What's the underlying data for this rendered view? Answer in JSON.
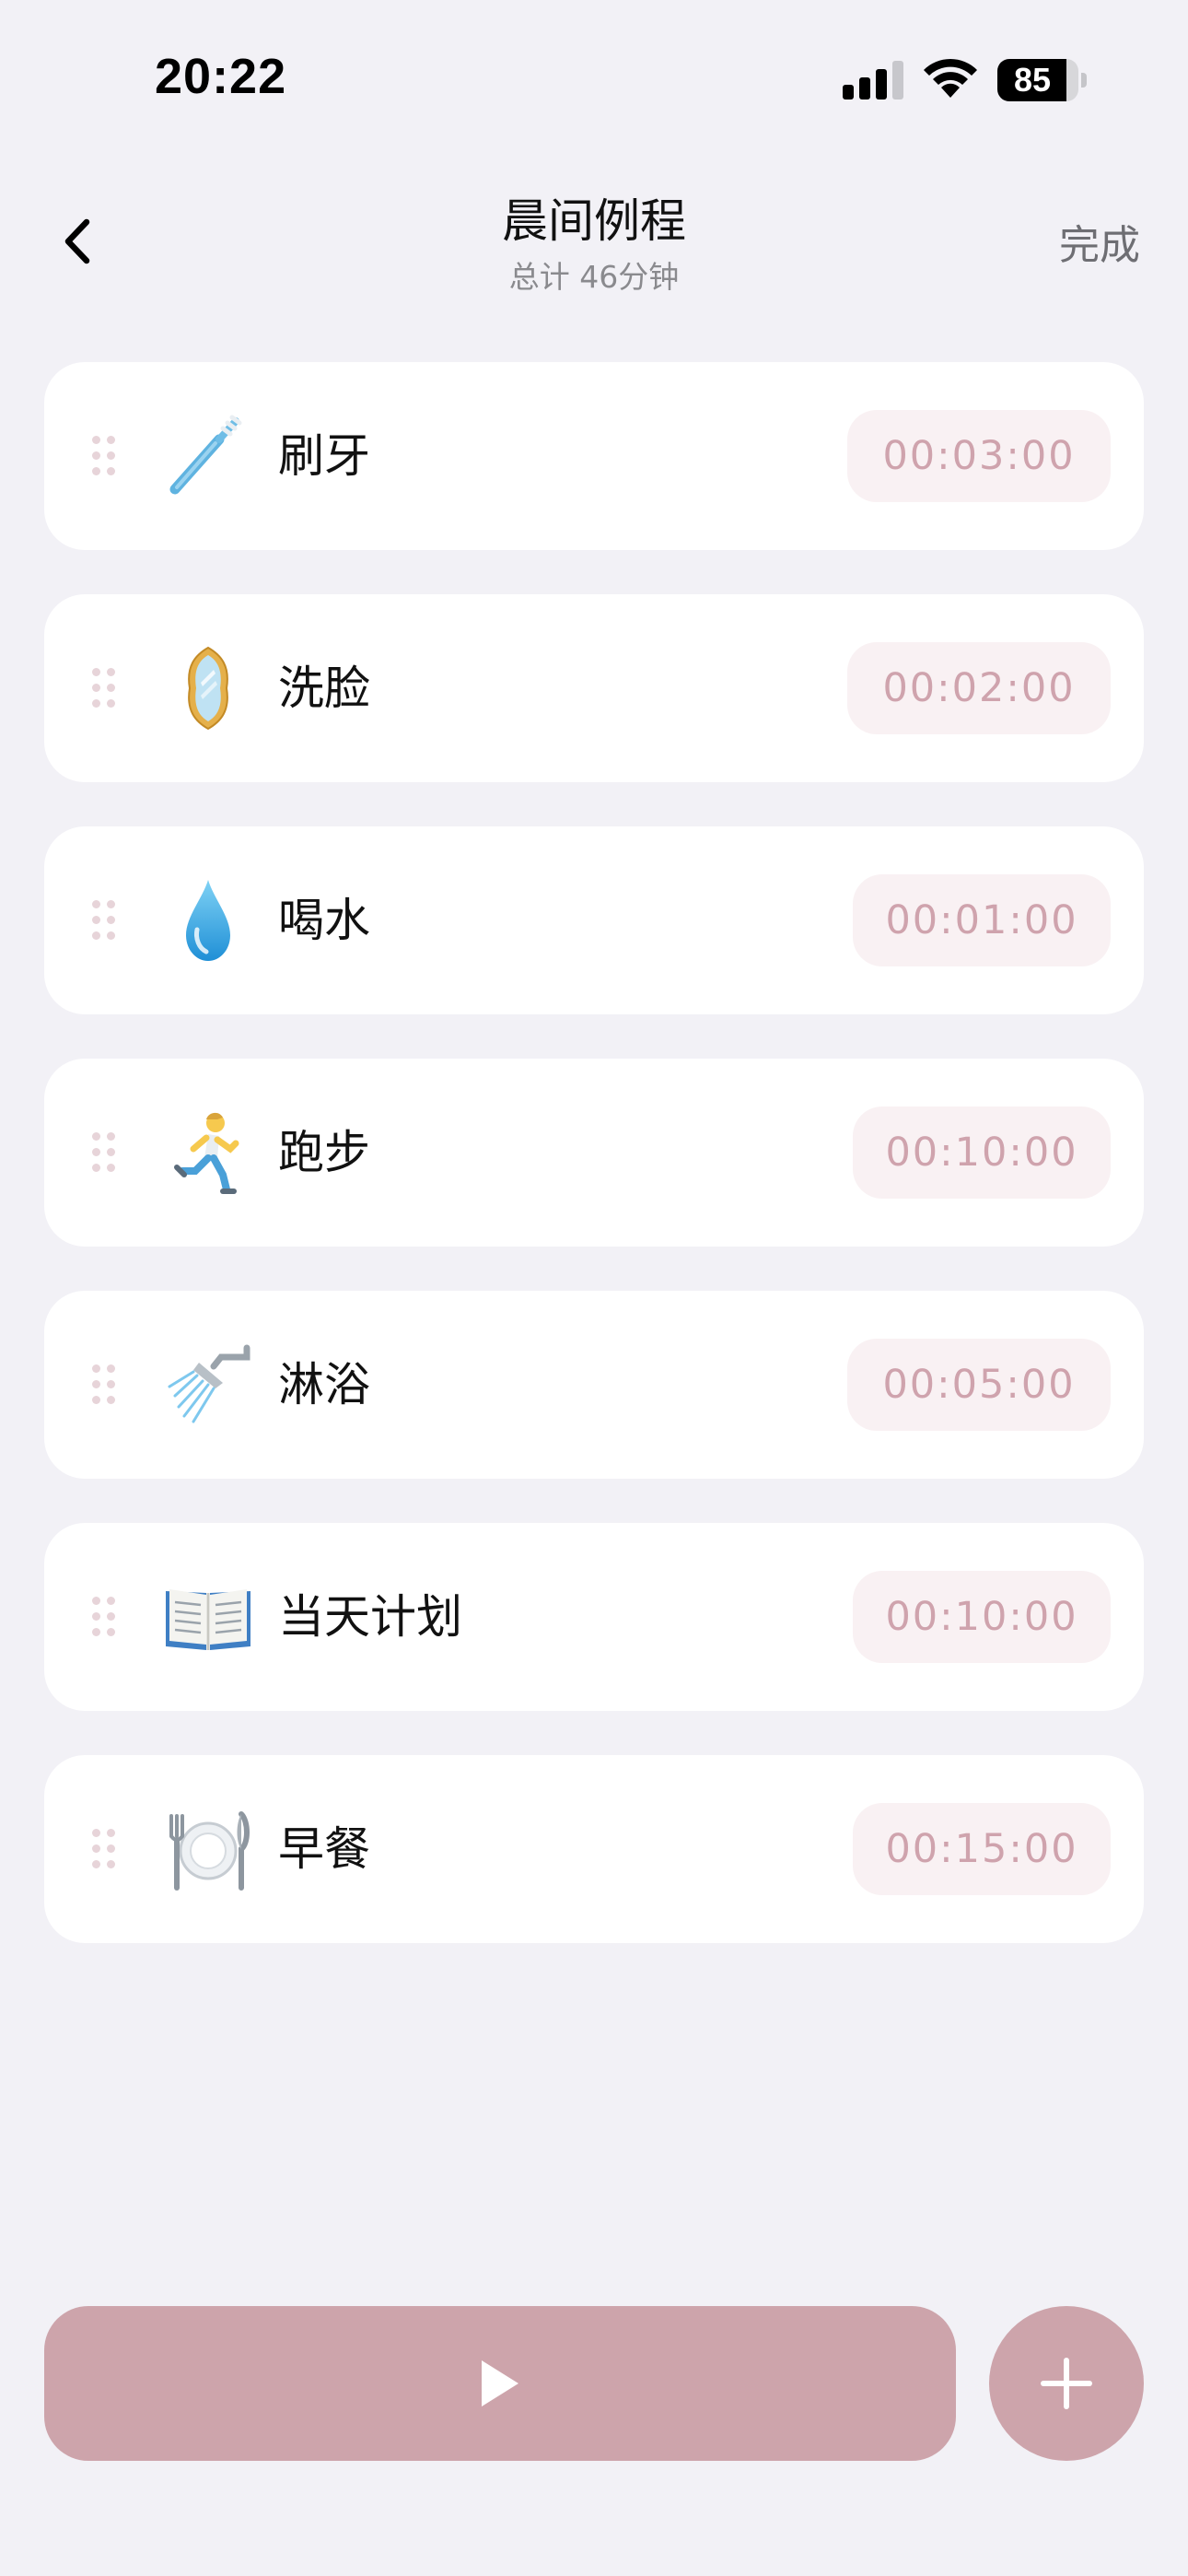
{
  "status_bar": {
    "time": "20:22",
    "battery_level": "85",
    "battery_percent": 85,
    "icons": [
      "signal-icon",
      "wifi-icon",
      "battery-icon"
    ]
  },
  "header": {
    "back_icon": "chevron-left-icon",
    "title": "晨间例程",
    "subtitle": "总计 46分钟",
    "done_label": "完成"
  },
  "routine": {
    "items": [
      {
        "label": "刷牙",
        "duration": "00:03:00",
        "icon": "toothbrush-icon"
      },
      {
        "label": "洗脸",
        "duration": "00:02:00",
        "icon": "mirror-icon"
      },
      {
        "label": "喝水",
        "duration": "00:01:00",
        "icon": "water-drop-icon"
      },
      {
        "label": "跑步",
        "duration": "00:10:00",
        "icon": "runner-icon"
      },
      {
        "label": "淋浴",
        "duration": "00:05:00",
        "icon": "shower-icon"
      },
      {
        "label": "当天计划",
        "duration": "00:10:00",
        "icon": "open-book-icon"
      },
      {
        "label": "早餐",
        "duration": "00:15:00",
        "icon": "plate-cutlery-icon"
      }
    ]
  },
  "actions": {
    "play_icon": "play-icon",
    "add_icon": "plus-icon"
  },
  "colors": {
    "background": "#f2f1f6",
    "card": "#ffffff",
    "accent": "#cda4ab",
    "pill_background": "#f9f1f3",
    "pill_text": "#cfa3ad",
    "drag_dot": "#e7d4d9"
  }
}
